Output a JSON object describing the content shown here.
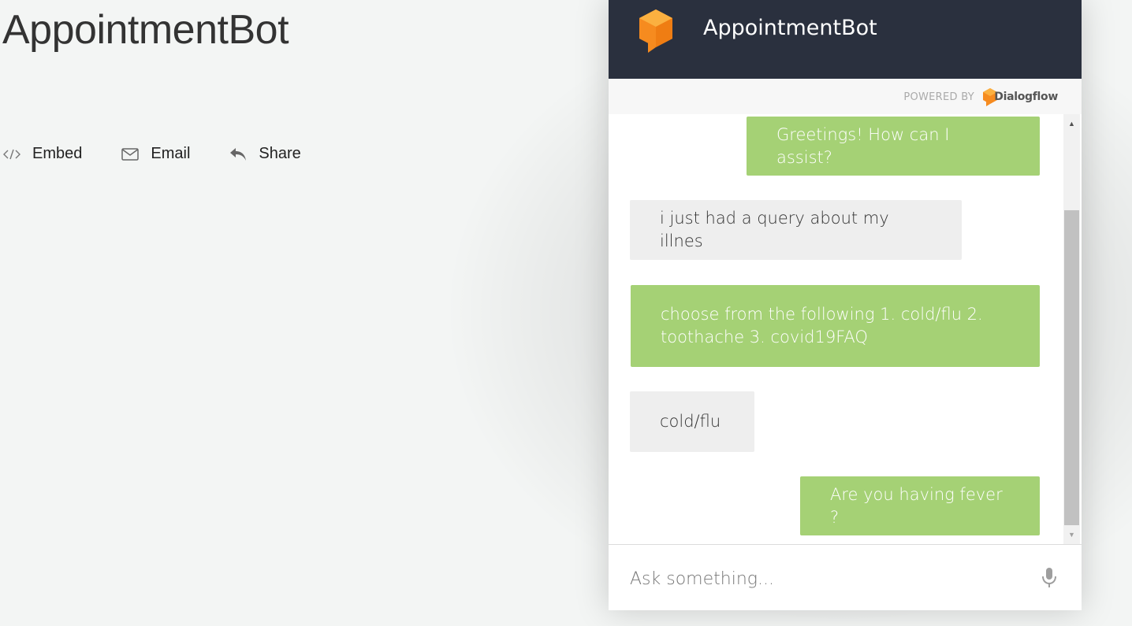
{
  "page": {
    "title": "AppointmentBot",
    "actions": [
      {
        "label": "Embed",
        "icon": "code-icon"
      },
      {
        "label": "Email",
        "icon": "envelope-icon"
      },
      {
        "label": "Share",
        "icon": "reply-arrow-icon"
      }
    ]
  },
  "widget": {
    "title": "AppointmentBot",
    "powered_by": "POWERED BY",
    "provider": "Dialogflow",
    "messages": [
      {
        "from": "bot",
        "text": "Greetings! How can I assist?"
      },
      {
        "from": "user",
        "text": "i just had a query about my illnes"
      },
      {
        "from": "bot",
        "text": "choose from the following 1. cold/flu 2. toothache 3. covid19FAQ"
      },
      {
        "from": "user",
        "text": "cold/flu"
      },
      {
        "from": "bot",
        "text": "Are you having fever ?"
      }
    ],
    "input_placeholder": "Ask something..."
  },
  "colors": {
    "header_bg": "#2a303e",
    "bot_bubble": "#a5d175",
    "user_bubble": "#eeeeee",
    "logo_orange": "#f68b1f"
  }
}
